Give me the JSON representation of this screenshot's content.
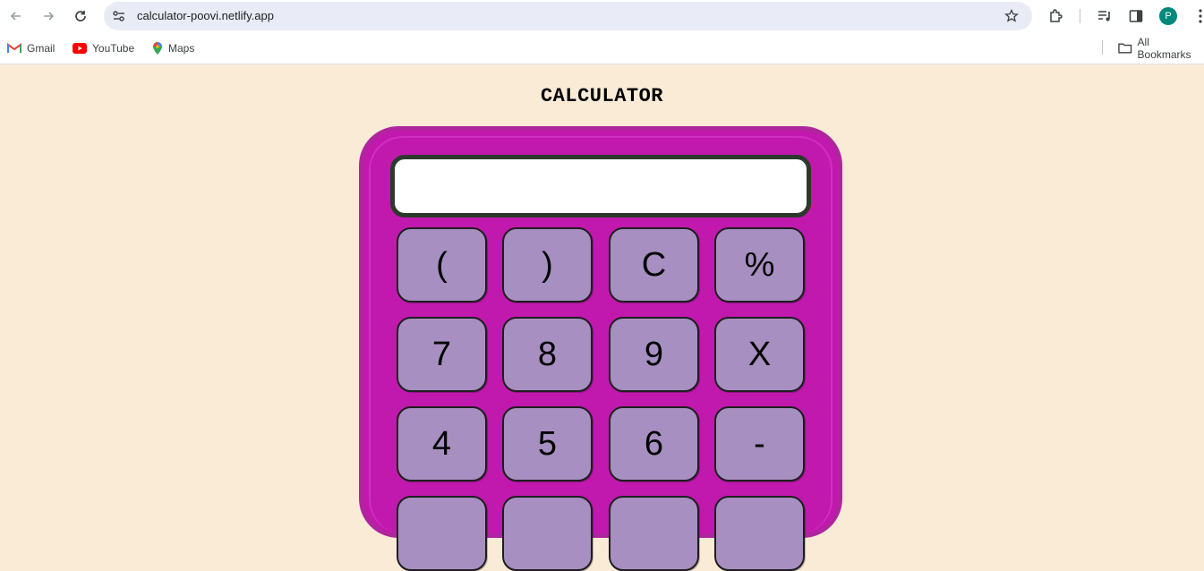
{
  "browser": {
    "url": "calculator-poovi.netlify.app",
    "profile_initial": "P",
    "bookmarks": [
      "Gmail",
      "YouTube",
      "Maps"
    ],
    "all_bookmarks": "All Bookmarks"
  },
  "page": {
    "title": "CALCULATOR",
    "display_value": ""
  },
  "keys": {
    "row1": [
      "(",
      ")",
      "C",
      "%"
    ],
    "row2": [
      "7",
      "8",
      "9",
      "X"
    ],
    "row3": [
      "4",
      "5",
      "6",
      "-"
    ],
    "row4": [
      "",
      "",
      "",
      ""
    ]
  },
  "colors": {
    "page_background": "#faebd7",
    "calculator_body": "#c118ae",
    "key_face": "#a78fc1",
    "display_border": "#2b3a2b"
  }
}
